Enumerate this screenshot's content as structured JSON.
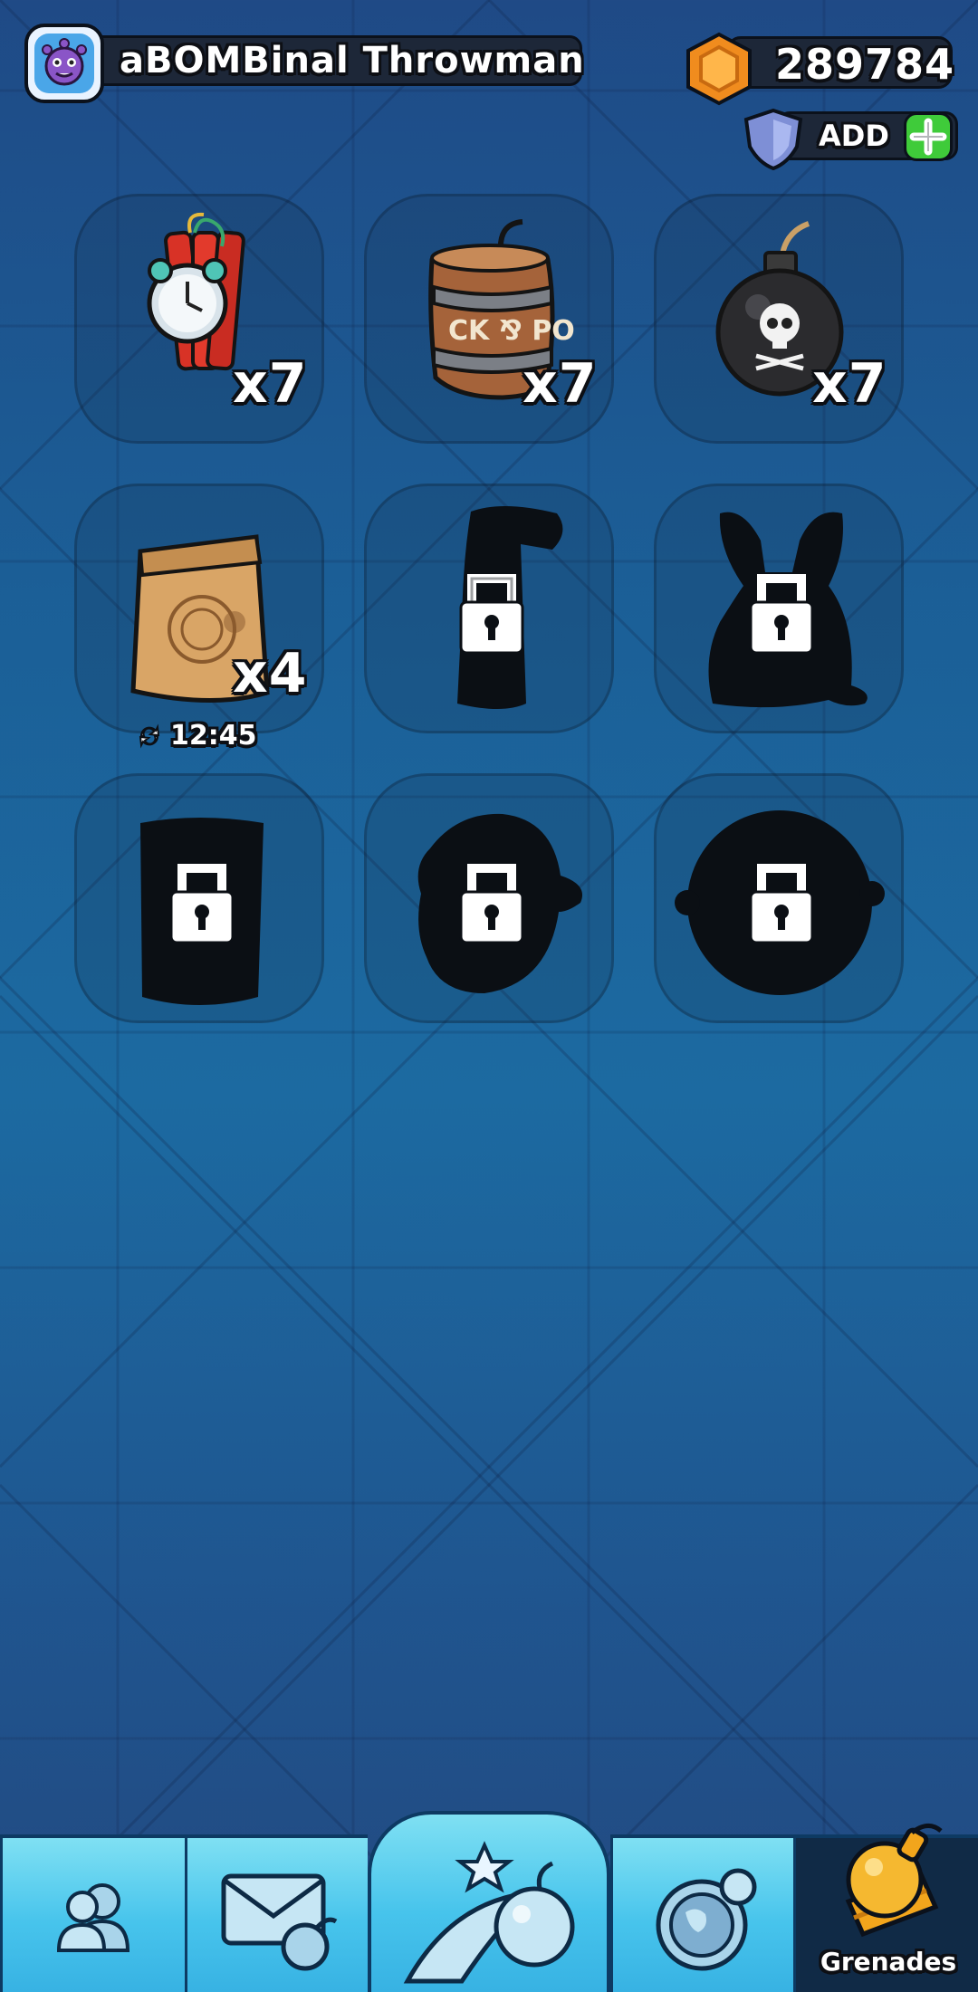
{
  "header": {
    "player_name": "aBOMBinal Throwman",
    "coins": "289784",
    "add_label": "ADD"
  },
  "grenades": [
    {
      "name": "alarm-dynamite",
      "locked": false,
      "count": "x7"
    },
    {
      "name": "powder-keg",
      "locked": false,
      "count": "x7"
    },
    {
      "name": "pirate-bomb",
      "locked": false,
      "count": "x7"
    },
    {
      "name": "paper-bag",
      "locked": false,
      "count": "x4",
      "timer": "12:45"
    },
    {
      "name": "locked-grenade-5",
      "locked": true
    },
    {
      "name": "locked-grenade-6",
      "locked": true
    },
    {
      "name": "locked-grenade-7",
      "locked": true
    },
    {
      "name": "locked-grenade-8",
      "locked": true
    },
    {
      "name": "locked-grenade-9",
      "locked": true
    }
  ],
  "nav": {
    "tabs": [
      {
        "name": "friends",
        "icon": "friends-icon"
      },
      {
        "name": "mail",
        "icon": "mail-icon"
      },
      {
        "name": "throw",
        "icon": "throw-icon"
      },
      {
        "name": "world",
        "icon": "globe-icon"
      },
      {
        "name": "grenades",
        "icon": "grenade-icon",
        "active": true
      }
    ],
    "active_label": "Grenades"
  },
  "colors": {
    "accent_green": "#3fcb3a",
    "nav_blue": "#47c4ec",
    "coin_orange": "#f08c1e"
  }
}
